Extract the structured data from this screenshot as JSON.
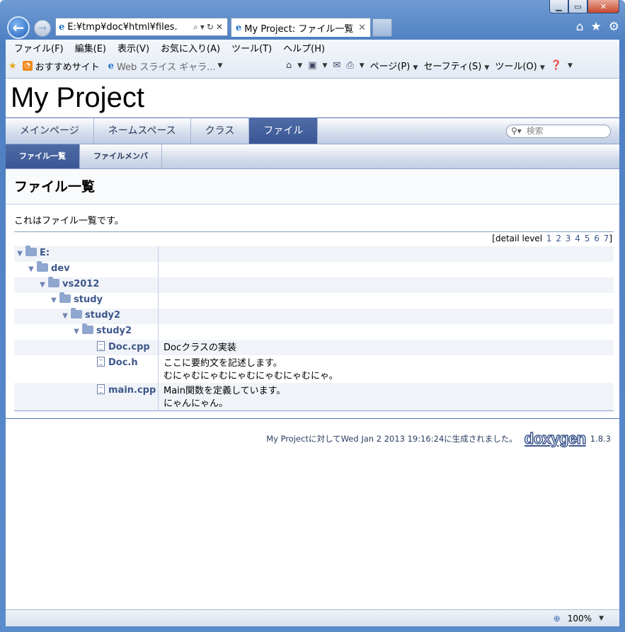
{
  "browser": {
    "address": "E:¥tmp¥doc¥html¥files.",
    "tab_title": "My Project: ファイル一覧",
    "menu": [
      "ファイル(F)",
      "編集(E)",
      "表示(V)",
      "お気に入り(A)",
      "ツール(T)",
      "ヘルプ(H)"
    ],
    "favorites": [
      "おすすめサイト",
      "Web スライス ギャラ..."
    ],
    "commands": [
      "ページ(P)",
      "セーフティ(S)",
      "ツール(O)"
    ],
    "zoom": "100%"
  },
  "page": {
    "project_name": "My Project",
    "main_tabs": [
      "メインページ",
      "ネームスペース",
      "クラス",
      "ファイル"
    ],
    "search_placeholder": "検索",
    "sub_tabs": [
      "ファイル一覧",
      "ファイルメンバ"
    ],
    "heading": "ファイル一覧",
    "description": "これはファイル一覧です。",
    "detail_level_label": "[detail level",
    "detail_levels": [
      "1",
      "2",
      "3",
      "4",
      "5",
      "6",
      "7"
    ],
    "tree": [
      {
        "name": "E:",
        "desc1": "",
        "desc2": ""
      },
      {
        "name": "dev",
        "desc1": "",
        "desc2": ""
      },
      {
        "name": "vs2012",
        "desc1": "",
        "desc2": ""
      },
      {
        "name": "study",
        "desc1": "",
        "desc2": ""
      },
      {
        "name": "study2",
        "desc1": "",
        "desc2": ""
      },
      {
        "name": "study2",
        "desc1": "",
        "desc2": ""
      },
      {
        "name": "Doc.cpp",
        "desc1": "Docクラスの実装",
        "desc2": ""
      },
      {
        "name": "Doc.h",
        "desc1": "ここに要約文を記述します。",
        "desc2": "むにゃむにゃむにゃむにゃむにゃむにゃ。"
      },
      {
        "name": "main.cpp",
        "desc1": "Main関数を定義しています。",
        "desc2": "にゃんにゃん。"
      }
    ],
    "footer_text": "My Projectに対してWed Jan 2 2013 19:16:24に生成されました。",
    "footer_logo": "doxygen",
    "footer_version": "1.8.3"
  }
}
